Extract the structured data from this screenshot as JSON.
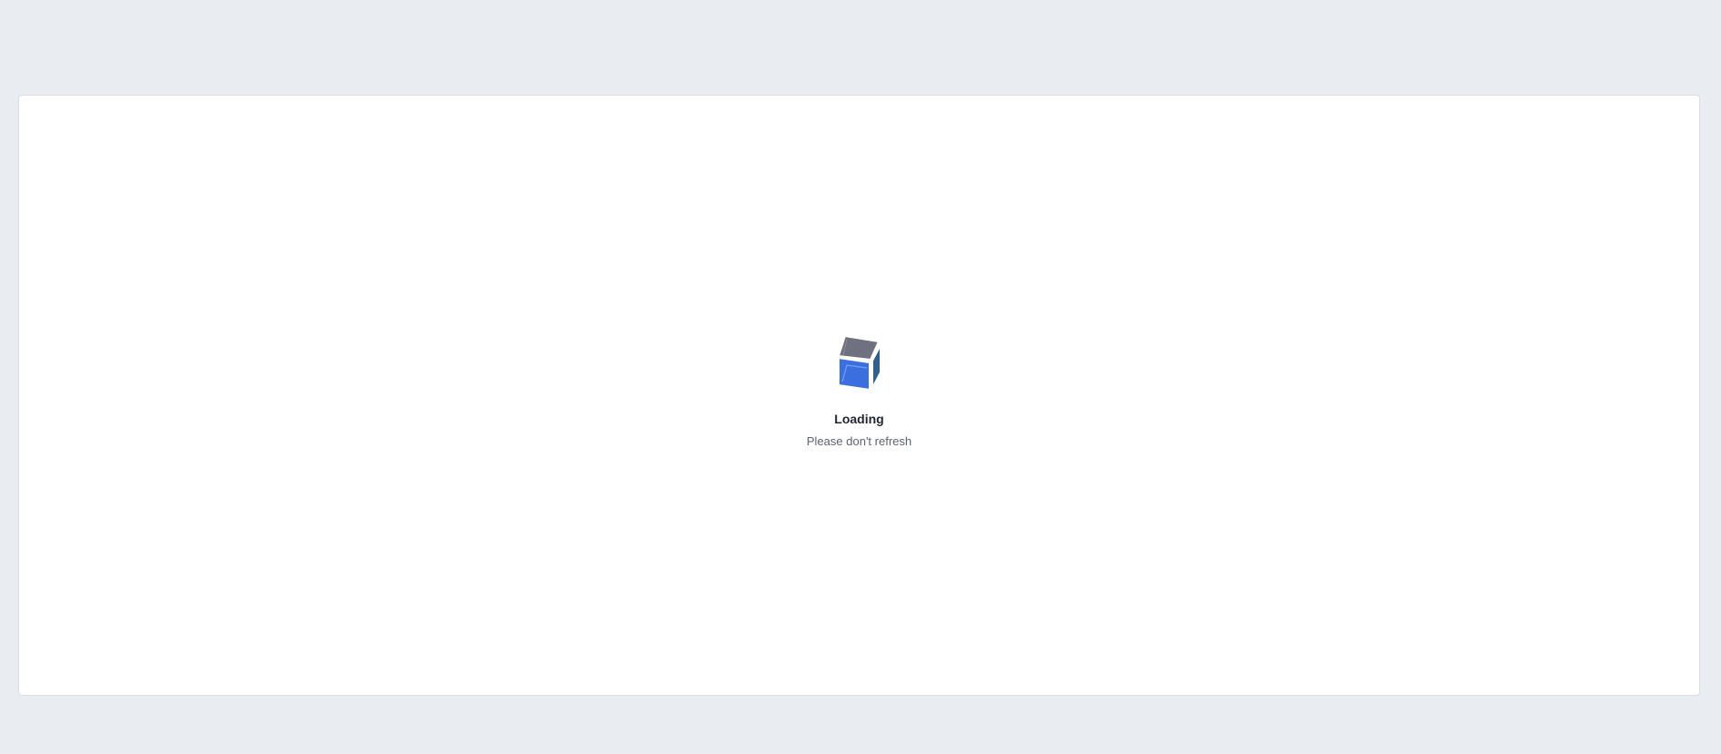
{
  "loader": {
    "icon": "cube-icon",
    "title": "Loading",
    "subtitle": "Please don't refresh",
    "colors": {
      "background": "#e9edf1",
      "panel": "#ffffff",
      "cube_top": "#6f7080",
      "cube_front": "#3b6fe0",
      "cube_side": "#2f5f8f"
    }
  }
}
